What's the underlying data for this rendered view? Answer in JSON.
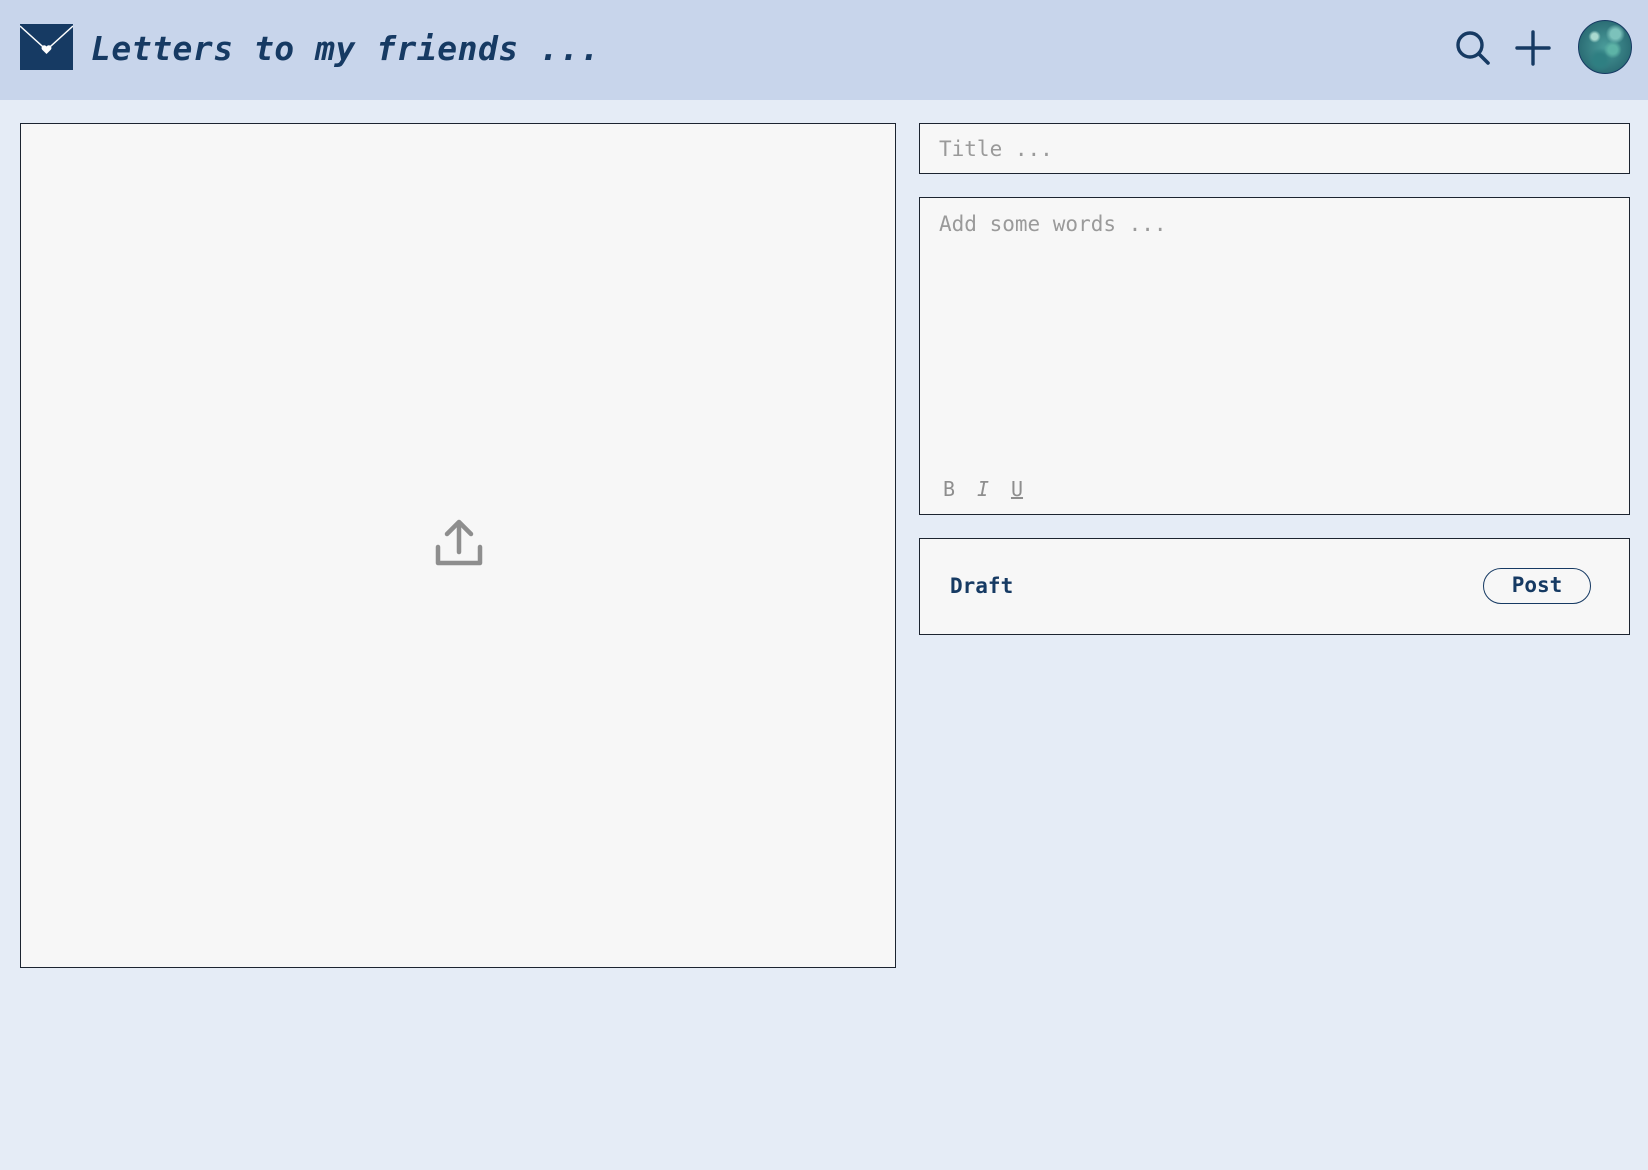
{
  "header": {
    "title": "Letters to my friends ...",
    "logo_icon": "envelope-heart-icon",
    "search_icon": "search-icon",
    "add_icon": "plus-icon",
    "avatar": "user-avatar"
  },
  "upload": {
    "icon": "upload-icon"
  },
  "form": {
    "title_placeholder": "Title ...",
    "title_value": "",
    "body_placeholder": "Add some words ...",
    "body_value": "",
    "format": {
      "bold_label": "B",
      "italic_label": "I",
      "underline_label": "U"
    }
  },
  "actions": {
    "draft_label": "Draft",
    "post_label": "Post"
  },
  "colors": {
    "header_bg": "#c8d5eb",
    "page_bg": "#e5ecf6",
    "accent": "#163a63",
    "panel_bg": "#f7f7f7",
    "placeholder": "#9a9a9a"
  }
}
